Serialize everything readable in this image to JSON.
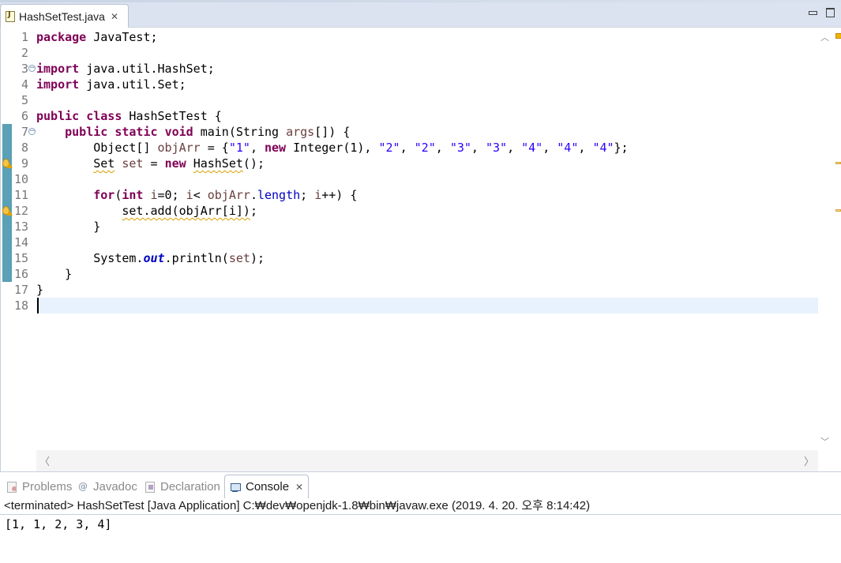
{
  "editor_tab": {
    "filename": "HashSetTest.java",
    "close_glyph": "✕"
  },
  "code": {
    "lines": [
      {
        "n": "1",
        "tokens": [
          [
            "kw",
            "package"
          ],
          [
            "",
            " JavaTest;"
          ]
        ]
      },
      {
        "n": "2",
        "tokens": []
      },
      {
        "n": "3",
        "tokens": [
          [
            "kw",
            "import"
          ],
          [
            "",
            " java.util.HashSet;"
          ]
        ],
        "fold": "⊖"
      },
      {
        "n": "4",
        "tokens": [
          [
            "kw",
            "import"
          ],
          [
            "",
            " java.util.Set;"
          ]
        ]
      },
      {
        "n": "5",
        "tokens": []
      },
      {
        "n": "6",
        "tokens": [
          [
            "kw",
            "public"
          ],
          [
            "",
            " "
          ],
          [
            "kw",
            "class"
          ],
          [
            "",
            " HashSetTest {"
          ]
        ]
      },
      {
        "n": "7",
        "tokens": [
          [
            "",
            "    "
          ],
          [
            "kw",
            "public"
          ],
          [
            "",
            " "
          ],
          [
            "kw",
            "static"
          ],
          [
            "",
            " "
          ],
          [
            "kw",
            "void"
          ],
          [
            "",
            " main(String "
          ],
          [
            "var",
            "args"
          ],
          [
            "",
            "[]) {"
          ]
        ],
        "fold": "⊖"
      },
      {
        "n": "8",
        "tokens": [
          [
            "",
            "        Object[] "
          ],
          [
            "var",
            "objArr"
          ],
          [
            "",
            " = {"
          ],
          [
            "str",
            "\"1\""
          ],
          [
            "",
            ", "
          ],
          [
            "kw",
            "new"
          ],
          [
            "",
            " Integer(1), "
          ],
          [
            "str",
            "\"2\""
          ],
          [
            "",
            ", "
          ],
          [
            "str",
            "\"2\""
          ],
          [
            "",
            ", "
          ],
          [
            "str",
            "\"3\""
          ],
          [
            "",
            ", "
          ],
          [
            "str",
            "\"3\""
          ],
          [
            "",
            ", "
          ],
          [
            "str",
            "\"4\""
          ],
          [
            "",
            ", "
          ],
          [
            "str",
            "\"4\""
          ],
          [
            "",
            ", "
          ],
          [
            "str",
            "\"4\""
          ],
          [
            "",
            "};"
          ]
        ]
      },
      {
        "n": "9",
        "tokens": [
          [
            "",
            "        "
          ],
          [
            "squig",
            "Set"
          ],
          [
            "",
            " "
          ],
          [
            "var",
            "set"
          ],
          [
            "",
            " = "
          ],
          [
            "kw",
            "new"
          ],
          [
            "",
            " "
          ],
          [
            "squig",
            "HashSet"
          ],
          [
            "",
            "();"
          ]
        ],
        "warning": true
      },
      {
        "n": "10",
        "tokens": []
      },
      {
        "n": "11",
        "tokens": [
          [
            "",
            "        "
          ],
          [
            "kw",
            "for"
          ],
          [
            "",
            "("
          ],
          [
            "kw",
            "int"
          ],
          [
            "",
            " "
          ],
          [
            "var",
            "i"
          ],
          [
            "",
            "=0; "
          ],
          [
            "var",
            "i"
          ],
          [
            "",
            "< "
          ],
          [
            "var",
            "objArr"
          ],
          [
            "",
            "."
          ],
          [
            "fld",
            "length"
          ],
          [
            "",
            "; "
          ],
          [
            "var",
            "i"
          ],
          [
            "",
            "++) {"
          ]
        ]
      },
      {
        "n": "12",
        "tokens": [
          [
            "",
            "            "
          ],
          [
            "squigvar",
            "set.add(objArr[i])"
          ],
          [
            "",
            ";"
          ]
        ],
        "warning": true
      },
      {
        "n": "13",
        "tokens": [
          [
            "",
            "        }"
          ]
        ]
      },
      {
        "n": "14",
        "tokens": []
      },
      {
        "n": "15",
        "tokens": [
          [
            "",
            "        System."
          ],
          [
            "sfld",
            "out"
          ],
          [
            "",
            ".println("
          ],
          [
            "var",
            "set"
          ],
          [
            "",
            ");"
          ]
        ]
      },
      {
        "n": "16",
        "tokens": [
          [
            "",
            "    }"
          ]
        ]
      },
      {
        "n": "17",
        "tokens": [
          [
            "",
            "}"
          ]
        ]
      },
      {
        "n": "18",
        "tokens": [],
        "current": true
      }
    ]
  },
  "panel_tabs": [
    {
      "label": "Problems",
      "icon": "problems-icon",
      "active": false
    },
    {
      "label": "Javadoc",
      "icon": "javadoc-icon",
      "glyph": "@",
      "active": false
    },
    {
      "label": "Declaration",
      "icon": "declaration-icon",
      "active": false
    },
    {
      "label": "Console",
      "icon": "console-icon",
      "active": true,
      "close_glyph": "✕"
    }
  ],
  "console": {
    "status": "<terminated> HashSetTest [Java Application] C:₩dev₩openjdk-1.8₩bin₩javaw.exe (2019. 4. 20. 오후 8:14:42)",
    "output": "[1, 1, 2, 3, 4]"
  },
  "colors": {
    "keyword": "#7f0055",
    "string": "#2a00ff",
    "field": "#0000c0",
    "local_variable": "#6a3e3e",
    "current_line": "#e8f2fe",
    "change_bar": "#5aa0b6"
  }
}
